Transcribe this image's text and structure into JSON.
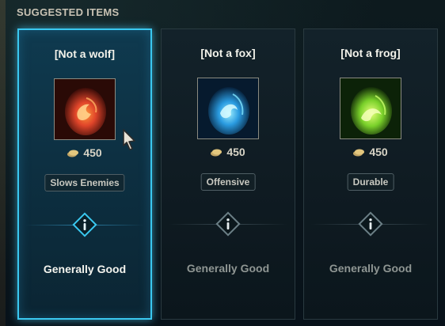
{
  "header": {
    "title": "SUGGESTED ITEMS"
  },
  "cards": [
    {
      "name": "[Not a wolf]",
      "price": "450",
      "tag": "Slows Enemies",
      "verdict": "Generally Good",
      "icon": "red-ember-egg-icon",
      "color": "#e0452a"
    },
    {
      "name": "[Not a fox]",
      "price": "450",
      "tag": "Offensive",
      "verdict": "Generally Good",
      "icon": "blue-water-egg-icon",
      "color": "#2a9be0"
    },
    {
      "name": "[Not a frog]",
      "price": "450",
      "tag": "Durable",
      "verdict": "Generally Good",
      "icon": "green-leaf-egg-icon",
      "color": "#7ad12a"
    }
  ],
  "selected_index": 0
}
